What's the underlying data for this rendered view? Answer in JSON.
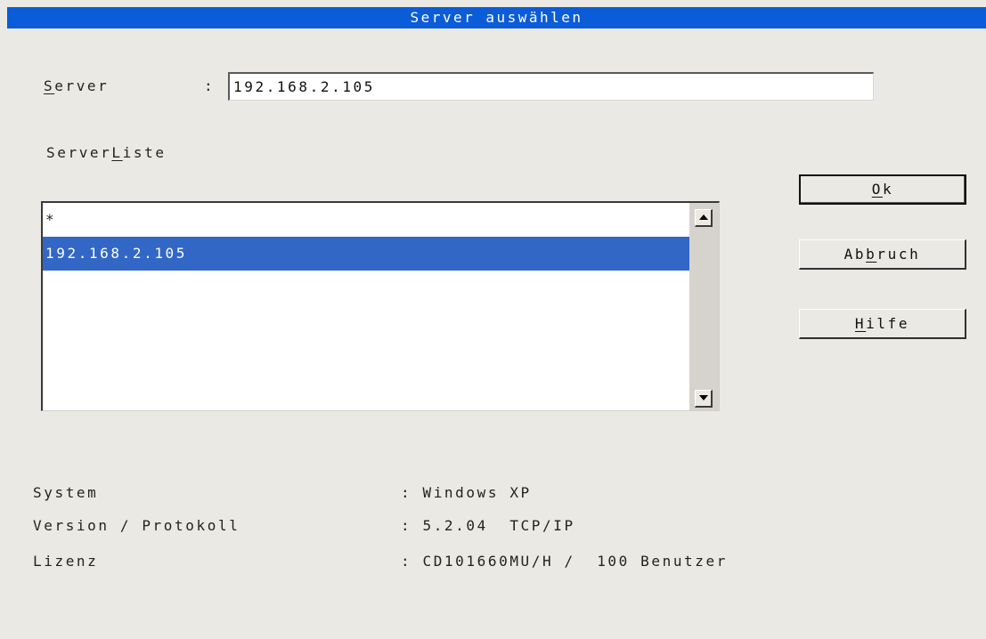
{
  "window": {
    "title": "Server auswählen"
  },
  "server_field": {
    "label_pre": "",
    "label_mnemonic": "S",
    "label_post": "erver",
    "separator": ":",
    "value": "192.168.2.105"
  },
  "serverlist": {
    "label_pre": "Server",
    "label_mnemonic": "L",
    "label_post": "iste",
    "items": [
      {
        "text": "*",
        "selected": false
      },
      {
        "text": "192.168.2.105",
        "selected": true
      }
    ],
    "scroll_up_icon": "arrow-up-icon",
    "scroll_down_icon": "arrow-down-icon"
  },
  "buttons": {
    "ok": {
      "pre": "",
      "mnemonic": "O",
      "post": "k"
    },
    "cancel": {
      "pre": "Ab",
      "mnemonic": "b",
      "post": "ruch"
    },
    "help": {
      "pre": "",
      "mnemonic": "H",
      "post": "ilfe"
    }
  },
  "info": {
    "system_label": "System",
    "system_value": ": Windows XP",
    "version_label": "Version / Protokoll",
    "version_value": ": 5.2.04  TCP/IP",
    "license_label": "Lizenz",
    "license_value": ": CD101660MU/H /  100 Benutzer"
  },
  "colors": {
    "titlebar": "#0b5cd8",
    "selection": "#3267c5",
    "background": "#ebe9e3"
  }
}
